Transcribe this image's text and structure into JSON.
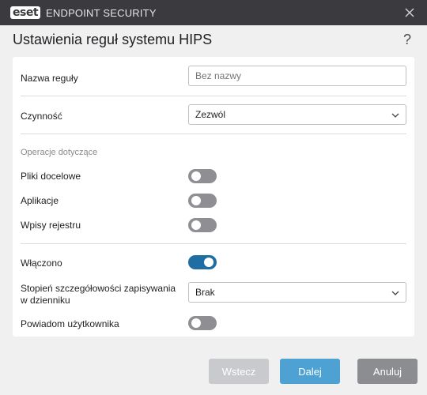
{
  "titlebar": {
    "logo_text": "eset",
    "product_name": "ENDPOINT SECURITY",
    "close_icon": "close-icon"
  },
  "dialog": {
    "title": "Ustawienia reguł systemu HIPS",
    "help_label": "?"
  },
  "form": {
    "rule_name": {
      "label": "Nazwa reguły",
      "placeholder": "Bez nazwy",
      "value": ""
    },
    "action": {
      "label": "Czynność",
      "selected": "Zezwól",
      "icon": "chevron-down-icon"
    },
    "operations_section": "Operacje dotyczące",
    "target_files": {
      "label": "Pliki docelowe",
      "on": false
    },
    "applications": {
      "label": "Aplikacje",
      "on": false
    },
    "registry_entries": {
      "label": "Wpisy rejestru",
      "on": false
    },
    "enabled": {
      "label": "Włączono",
      "on": true
    },
    "log_severity": {
      "label_line1": "Stopień szczegółowości zapisywania",
      "label_line2": "w dzienniku",
      "selected": "Brak",
      "icon": "chevron-down-icon"
    },
    "notify_user": {
      "label": "Powiadom użytkownika",
      "on": false
    }
  },
  "footer": {
    "back_label": "Wstecz",
    "next_label": "Dalej",
    "cancel_label": "Anuluj"
  },
  "colors": {
    "titlebar": "#3a3a3f",
    "toggle_on": "#1f6ea3",
    "toggle_off": "#8e8e93",
    "primary_button": "#4ea1d3",
    "disabled_button": "#c9cacd",
    "secondary_button": "#8c8d91"
  }
}
